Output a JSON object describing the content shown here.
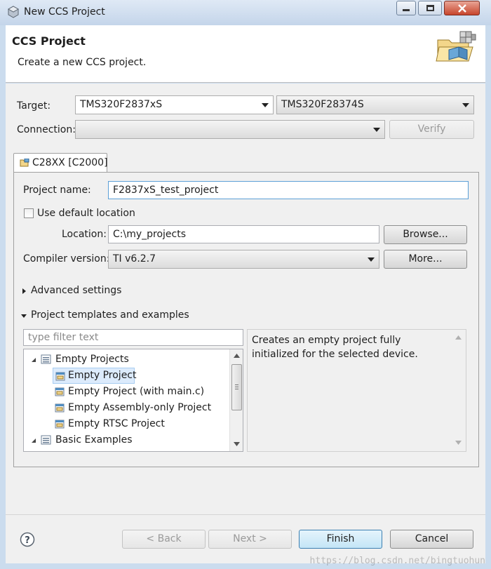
{
  "window": {
    "title": "New CCS Project"
  },
  "header": {
    "title": "CCS Project",
    "subtitle": "Create a new CCS project."
  },
  "target": {
    "label": "Target:",
    "family_value": "TMS320F2837xS",
    "device_value": "TMS320F28374S"
  },
  "connection": {
    "label": "Connection:",
    "value": "",
    "verify_label": "Verify"
  },
  "tab": {
    "label": "C28XX [C2000]"
  },
  "project": {
    "name_label": "Project name:",
    "name_value": "F2837xS_test_project",
    "default_location_label": "Use default location",
    "default_location_checked": false,
    "location_label": "Location:",
    "location_value": "C:\\my_projects",
    "browse_label": "Browse...",
    "compiler_label": "Compiler version:",
    "compiler_value": "TI v6.2.7",
    "more_label": "More...",
    "advanced_label": "Advanced settings",
    "templates_label": "Project templates and examples"
  },
  "templates": {
    "filter_placeholder": "type filter text",
    "tree": [
      {
        "label": "Empty Projects",
        "level": 0,
        "expanded": true
      },
      {
        "label": "Empty Project",
        "level": 1,
        "selected": true
      },
      {
        "label": "Empty Project (with main.c)",
        "level": 1
      },
      {
        "label": "Empty Assembly-only Project",
        "level": 1
      },
      {
        "label": "Empty RTSC Project",
        "level": 1
      },
      {
        "label": "Basic Examples",
        "level": 0,
        "expanded": true
      }
    ],
    "description": "Creates an empty project fully initialized for the selected device."
  },
  "footer": {
    "back_label": "< Back",
    "next_label": "Next >",
    "finish_label": "Finish",
    "cancel_label": "Cancel"
  },
  "watermark": "https://blog.csdn.net/bingtuohun",
  "colors": {
    "title_bar": "#c4d5ea",
    "dialog_bg": "#f0f0f0",
    "selection": "#dcebfc",
    "close_button": "#c7462c"
  }
}
